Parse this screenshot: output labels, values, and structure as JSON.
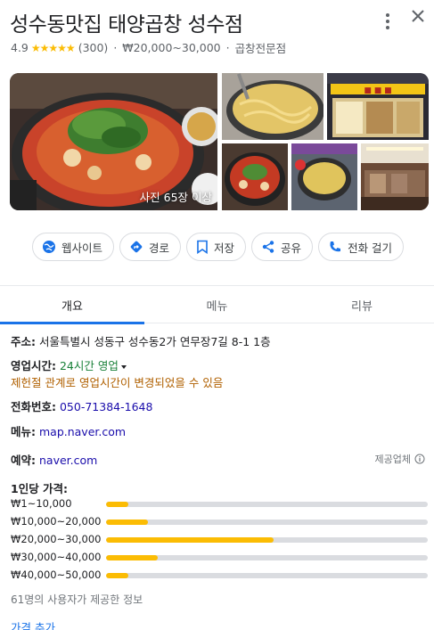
{
  "place": {
    "title": "성수동맛집 태양곱창 성수점",
    "rating": "4.9",
    "stars": "★★★★★",
    "review_count": "(300)",
    "price_level": "₩20,000~30,000",
    "category": "곱창전문점",
    "sep": "·"
  },
  "photos": {
    "count_label": "사진 65장 이상"
  },
  "actions": {
    "website": "웹사이트",
    "directions": "경로",
    "save": "저장",
    "share": "공유",
    "call": "전화 걸기"
  },
  "tabs": {
    "overview": "개요",
    "menu": "메뉴",
    "reviews": "리뷰"
  },
  "info": {
    "address_label": "주소:",
    "address": "서울특별시 성동구 성수동2가 연무장7길 8-1 1층",
    "hours_label": "영업시간:",
    "hours_value": "24시간 영업",
    "hours_note": "제헌절 관계로 영업시간이 변경되었을 수 있음",
    "phone_label": "전화번호:",
    "phone": "050-71384-1648",
    "menu_label": "메뉴:",
    "menu_link": "map.naver.com",
    "reserve_label": "예약:",
    "reserve_link": "naver.com",
    "provider": "제공업체"
  },
  "price": {
    "heading": "1인당 가격:",
    "ranges": [
      {
        "label": "₩1~10,000",
        "share": 0.07
      },
      {
        "label": "₩10,000~20,000",
        "share": 0.13
      },
      {
        "label": "₩20,000~30,000",
        "share": 0.52
      },
      {
        "label": "₩30,000~40,000",
        "share": 0.16
      },
      {
        "label": "₩40,000~50,000",
        "share": 0.07
      }
    ],
    "footnote": "61명의 사용자가 제공한 정보",
    "add_link": "가격 추가"
  },
  "colors": {
    "accent": "#1a73e8",
    "star": "#fbbc04",
    "open_green": "#188038",
    "warning": "#b06000"
  }
}
